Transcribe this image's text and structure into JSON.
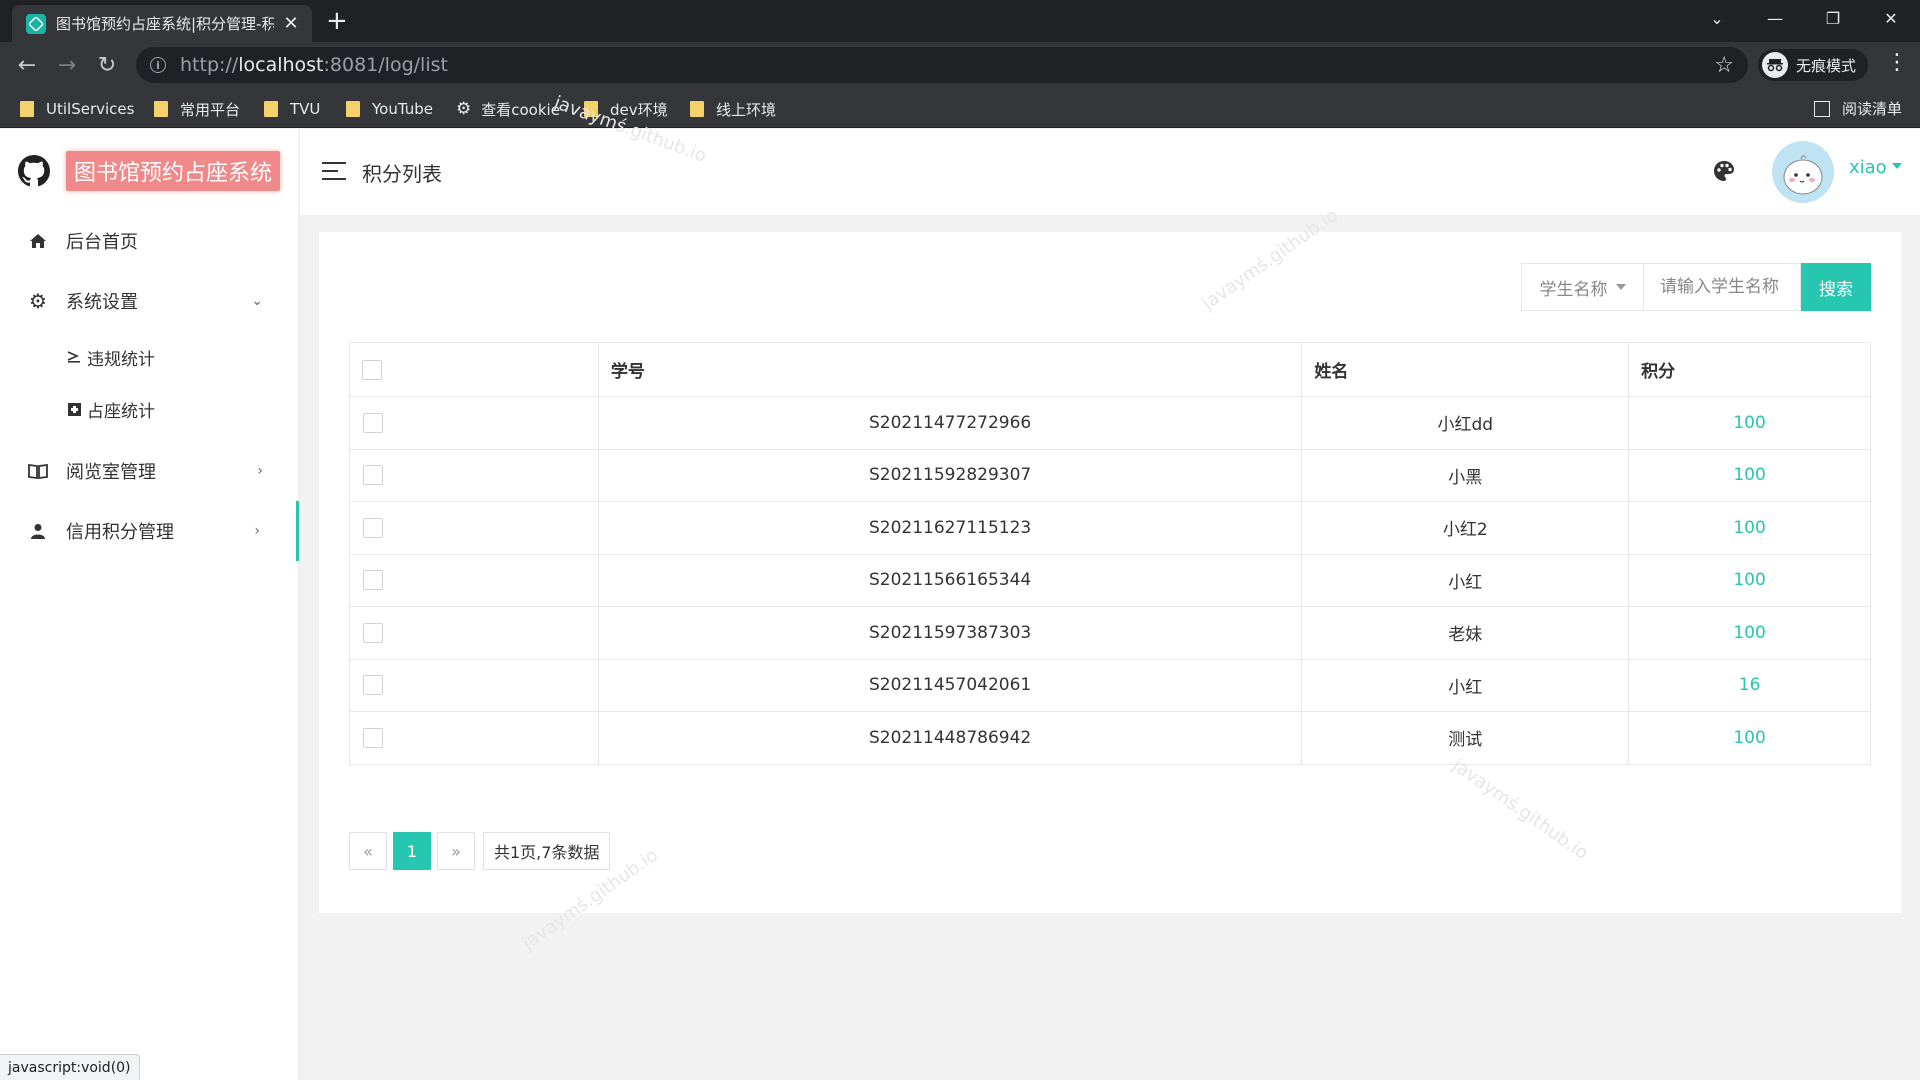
{
  "browser": {
    "tab_title": "图书馆预约占座系统|积分管理-积",
    "url_prefix": "http://",
    "url_host": "localhost",
    "url_rest": ":8081/log/list",
    "incognito_label": "无痕模式",
    "reading_list_label": "阅读清单",
    "bookmarks": [
      "UtilServices",
      "常用平台",
      "TVU",
      "YouTube",
      "查看cookie",
      "dev环境",
      "线上环境"
    ],
    "status_text": "javascript:void(0)"
  },
  "app": {
    "logo_text": "图书馆预约占座系统",
    "page_title": "积分列表",
    "username": "xiao",
    "accent": "#26c6b0"
  },
  "sidebar": {
    "items": [
      {
        "label": "后台首页",
        "icon": "home-icon"
      },
      {
        "label": "系统设置",
        "icon": "gear-icon",
        "caret": "⌄"
      },
      {
        "label": "违规统计",
        "icon": "chart-icon"
      },
      {
        "label": "占座统计",
        "icon": "square-icon"
      },
      {
        "label": "阅览室管理",
        "icon": "book-icon",
        "caret": "›"
      },
      {
        "label": "信用积分管理",
        "icon": "user-icon",
        "caret": "›"
      }
    ]
  },
  "search": {
    "select_label": "学生名称",
    "placeholder": "请输入学生名称",
    "button_label": "搜索"
  },
  "table": {
    "headers": [
      "学号",
      "姓名",
      "积分"
    ],
    "rows": [
      {
        "no": "S20211477272966",
        "name": "小红dd",
        "score": "100"
      },
      {
        "no": "S20211592829307",
        "name": "小黑",
        "score": "100"
      },
      {
        "no": "S20211627115123",
        "name": "小红2",
        "score": "100"
      },
      {
        "no": "S20211566165344",
        "name": "小红",
        "score": "100"
      },
      {
        "no": "S20211597387303",
        "name": "老妹",
        "score": "100"
      },
      {
        "no": "S20211457042061",
        "name": "小红",
        "score": "16"
      },
      {
        "no": "S20211448786942",
        "name": "测试",
        "score": "100"
      }
    ]
  },
  "pagination": {
    "prev": "«",
    "current": "1",
    "next": "»",
    "total_text": "共1页,7条数据"
  },
  "watermark_text": "javaymś.github.io"
}
